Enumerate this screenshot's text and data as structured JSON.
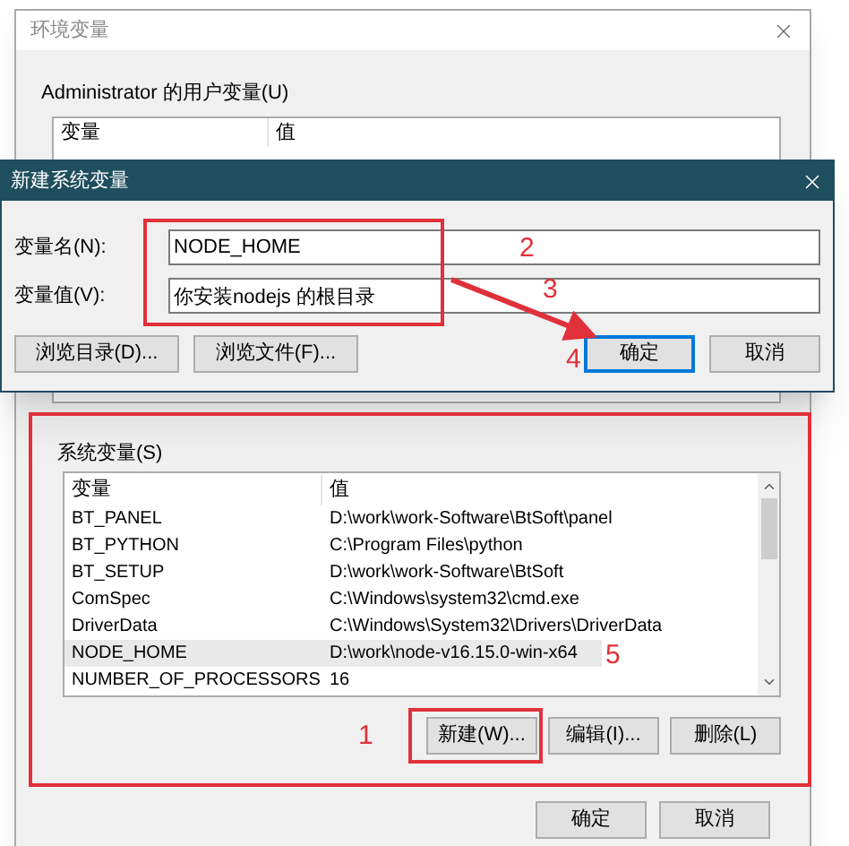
{
  "background_window": {
    "title": "环境变量",
    "user_variables": {
      "label": "Administrator 的用户变量(U)",
      "columns": [
        "变量",
        "值"
      ]
    },
    "system_variables": {
      "label": "系统变量(S)",
      "columns": [
        "变量",
        "值"
      ],
      "rows": [
        {
          "name": "BT_PANEL",
          "value": "D:\\work\\work-Software\\BtSoft\\panel",
          "selected": false
        },
        {
          "name": "BT_PYTHON",
          "value": "C:\\Program Files\\python",
          "selected": false
        },
        {
          "name": "BT_SETUP",
          "value": "D:\\work\\work-Software\\BtSoft",
          "selected": false
        },
        {
          "name": "ComSpec",
          "value": "C:\\Windows\\system32\\cmd.exe",
          "selected": false
        },
        {
          "name": "DriverData",
          "value": "C:\\Windows\\System32\\Drivers\\DriverData",
          "selected": false
        },
        {
          "name": "NODE_HOME",
          "value": "D:\\work\\node-v16.15.0-win-x64",
          "selected": true
        },
        {
          "name": "NUMBER_OF_PROCESSORS",
          "value": "16",
          "selected": false
        }
      ],
      "buttons": [
        "新建(W)...",
        "编辑(I)...",
        "删除(L)"
      ]
    },
    "buttons": [
      "确定",
      "取消"
    ]
  },
  "dialog": {
    "title": "新建系统变量",
    "fields": [
      {
        "label": "变量名(N):",
        "value": "NODE_HOME"
      },
      {
        "label": "变量值(V):",
        "value": "你安装nodejs 的根目录"
      }
    ],
    "buttons": [
      {
        "label": "浏览目录(D)...",
        "default": false
      },
      {
        "label": "浏览文件(F)...",
        "default": false
      },
      {
        "label": "确定",
        "default": true
      },
      {
        "label": "取消",
        "default": false
      }
    ]
  },
  "annotations": [
    "1",
    "2",
    "3",
    "4",
    "5"
  ]
}
